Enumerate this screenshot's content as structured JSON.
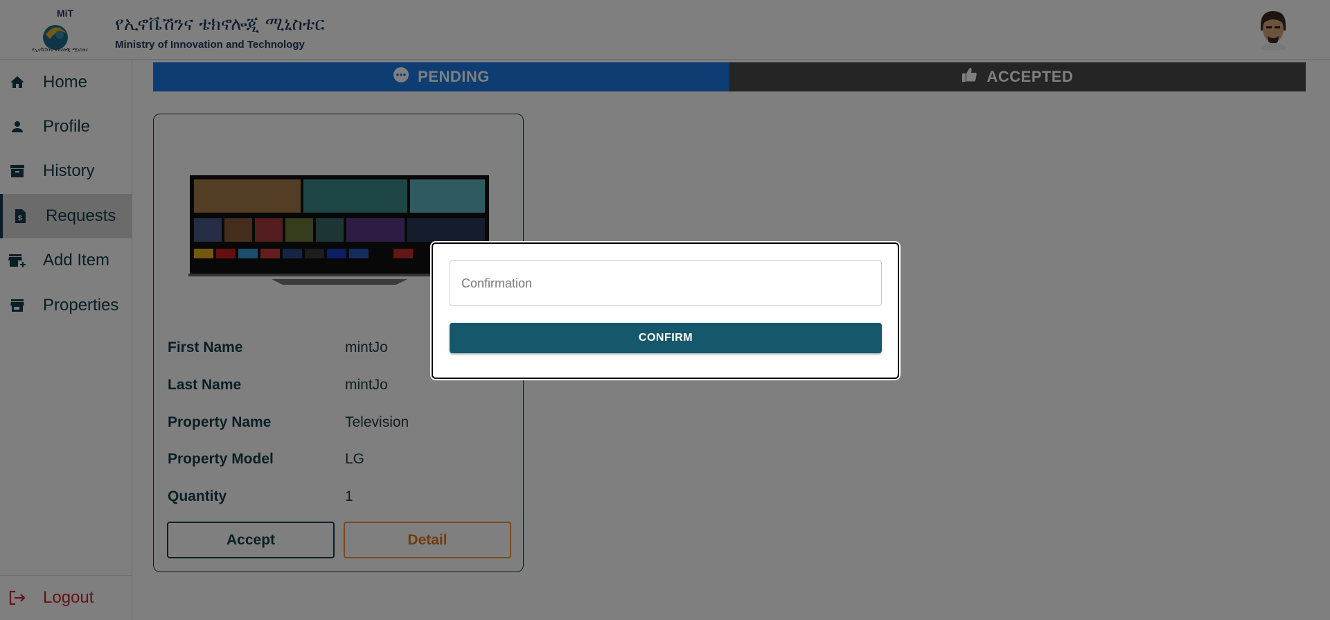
{
  "header": {
    "logo_text": "MiT",
    "logo_caption": "የኢኖቬሽንና ቴክኖሎጂ ሚኒስቴር",
    "org_name_amharic": "የኢኖቬሽንና ቴክኖሎጂ ሚኒስቴር",
    "org_name_english": "Ministry of Innovation and Technology"
  },
  "sidebar": {
    "items": [
      {
        "label": "Home",
        "icon": "home-icon"
      },
      {
        "label": "Profile",
        "icon": "person-icon"
      },
      {
        "label": "History",
        "icon": "archive-icon"
      },
      {
        "label": "Requests",
        "icon": "request-document-icon",
        "active": true
      },
      {
        "label": "Add Item",
        "icon": "add-store-icon"
      },
      {
        "label": "Properties",
        "icon": "store-icon"
      }
    ],
    "logout_label": "Logout"
  },
  "tabs": {
    "pending_label": "PENDING",
    "accepted_label": "ACCEPTED"
  },
  "card": {
    "image": "television-image",
    "fields": [
      {
        "label": "First Name",
        "value": "mintJo"
      },
      {
        "label": "Last Name",
        "value": "mintJo"
      },
      {
        "label": "Property Name",
        "value": "Television"
      },
      {
        "label": "Property Model",
        "value": "LG"
      },
      {
        "label": "Quantity",
        "value": "1"
      }
    ],
    "accept_label": "Accept",
    "detail_label": "Detail"
  },
  "modal": {
    "input_placeholder": "Confirmation",
    "input_value": "",
    "confirm_label": "CONFIRM"
  },
  "colors": {
    "primary": "#133c4a",
    "tab_active": "#1c7ae6",
    "tab_inactive": "#4a4a4a",
    "detail_accent": "#e07a1c",
    "logout": "#c62828",
    "confirm_button": "#15586b"
  }
}
